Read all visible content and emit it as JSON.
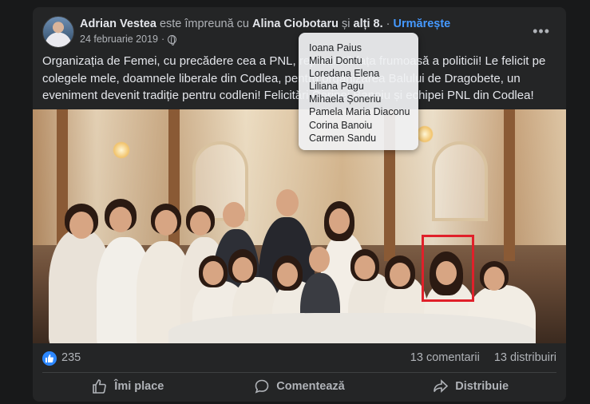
{
  "post": {
    "author": "Adrian Vestea",
    "with_text": "este împreună cu",
    "tagged": "Alina Ciobotaru",
    "and_text": "și",
    "others": "alți 8.",
    "separator": "·",
    "follow": "Urmărește",
    "date": "24 februarie 2019",
    "date_sep": "·",
    "privacy_icon": "globe-icon",
    "more_icon": "more-options-icon",
    "more_label": "•••",
    "text_lines": [
      "Organizația de Femei, cu precădere cea a PNL, reprezintă fața frumoasă a politicii! Le felicit pe",
      "colegele mele, doamnele liberale din Codlea, pentru organizarea Balului de Dragobete, un",
      "eveniment devenit tradiție pentru codleni! Felicitări Corinei Banoiu și echipei PNL din Codlea!"
    ]
  },
  "tooltip": {
    "names": [
      "Ioana Paius",
      "Mihai Dontu",
      "Loredana Elena",
      "Liliana Pagu",
      "Mihaela Șoneriu",
      "Pamela Maria Diaconu",
      "Corina Banoiu",
      "Carmen Sandu"
    ]
  },
  "stats": {
    "likes": "235",
    "comments": "13 comentarii",
    "shares": "13 distribuiri"
  },
  "actions": {
    "like": "Îmi place",
    "comment": "Comentează",
    "share": "Distribuie"
  },
  "colors": {
    "accent": "#4599ff",
    "background": "#242526",
    "highlight_box": "#e0202a"
  }
}
